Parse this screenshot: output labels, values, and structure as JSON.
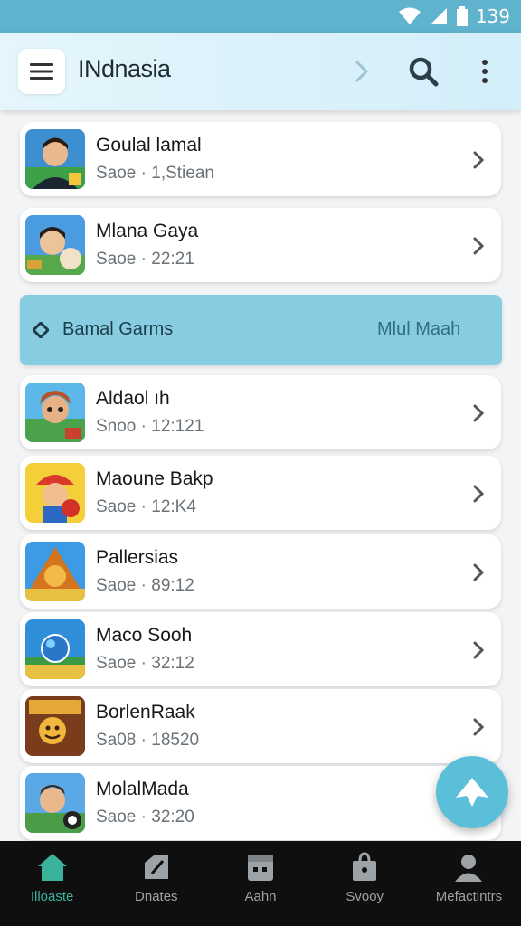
{
  "status_bar": {
    "time": "139"
  },
  "app_bar": {
    "title": "INdnasia"
  },
  "games_top": [
    {
      "title": "Goulal lamal",
      "subtitle": "Saoe · 1,Stiean"
    },
    {
      "title": "Mlana Gaya",
      "subtitle": "Saoe · 22:21"
    }
  ],
  "section": {
    "title": "Bamal Garms",
    "action": "Mlul Maah"
  },
  "games_bottom": [
    {
      "title": "Aldaol ıh",
      "subtitle": "Snoo · 12:121"
    },
    {
      "title": "Maoune Bakp",
      "subtitle": "Saoe · 12:K4"
    },
    {
      "title": "Pallersias",
      "subtitle": "Saoe · 89:12"
    },
    {
      "title": "Maco Sooh",
      "subtitle": "Saoe · 32:12"
    },
    {
      "title": "BorlenRaak",
      "subtitle": "Sa08 · 18520"
    },
    {
      "title": "MolalMada",
      "subtitle": "Saoe · 32:20"
    }
  ],
  "bottom_nav": [
    {
      "label": "Illoaste",
      "icon": "home-icon"
    },
    {
      "label": "Dnates",
      "icon": "edit-icon"
    },
    {
      "label": "Aahn",
      "icon": "calendar-icon"
    },
    {
      "label": "Svooy",
      "icon": "shopping-bag-icon"
    },
    {
      "label": "Mefactintrs",
      "icon": "profile-icon"
    }
  ],
  "colors": {
    "status_bar": "#5fb3cc",
    "app_bar": "#dff3fb",
    "section": "#88cce1",
    "fab": "#5cbfd9",
    "nav_active": "#3bb39a",
    "nav_bg": "#0f0f10"
  }
}
